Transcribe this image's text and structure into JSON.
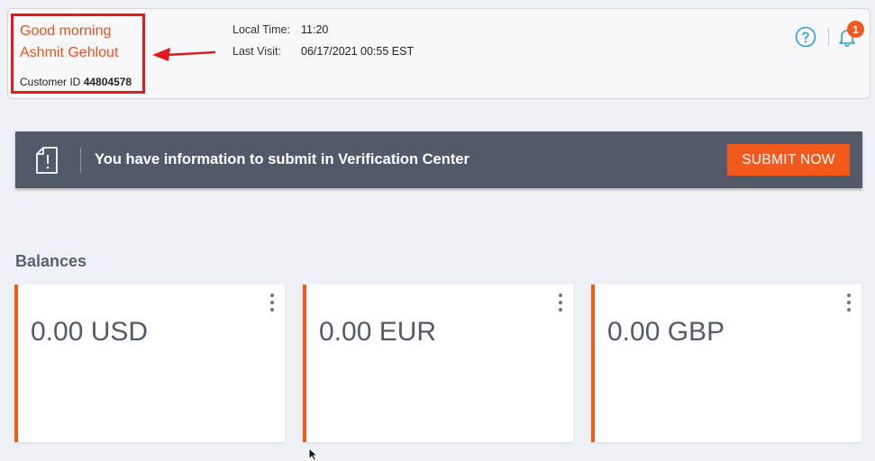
{
  "header": {
    "greeting": "Good morning",
    "user_name": "Ashmit Gehlout",
    "customer_id_label": "Customer ID",
    "customer_id_value": "44804578",
    "local_time_label": "Local Time:",
    "local_time_value": "11:20",
    "last_visit_label": "Last Visit:",
    "last_visit_value": "06/17/2021 00:55 EST",
    "notification_count": "1",
    "icons": [
      "help-icon",
      "bell-icon"
    ]
  },
  "banner": {
    "message": "You have information to submit in Verification Center",
    "button_label": "SUBMIT NOW",
    "icon": "document-icon"
  },
  "balances": {
    "title": "Balances",
    "cards": [
      {
        "amount": "0.00 USD"
      },
      {
        "amount": "0.00 EUR"
      },
      {
        "amount": "0.00 GBP"
      }
    ]
  },
  "colors": {
    "accent": "#f15a1c",
    "banner_bg": "#525a6a",
    "highlight_box": "#e01a1f",
    "greeting_text": "#e8521c",
    "page_bg": "#eff0f4"
  }
}
